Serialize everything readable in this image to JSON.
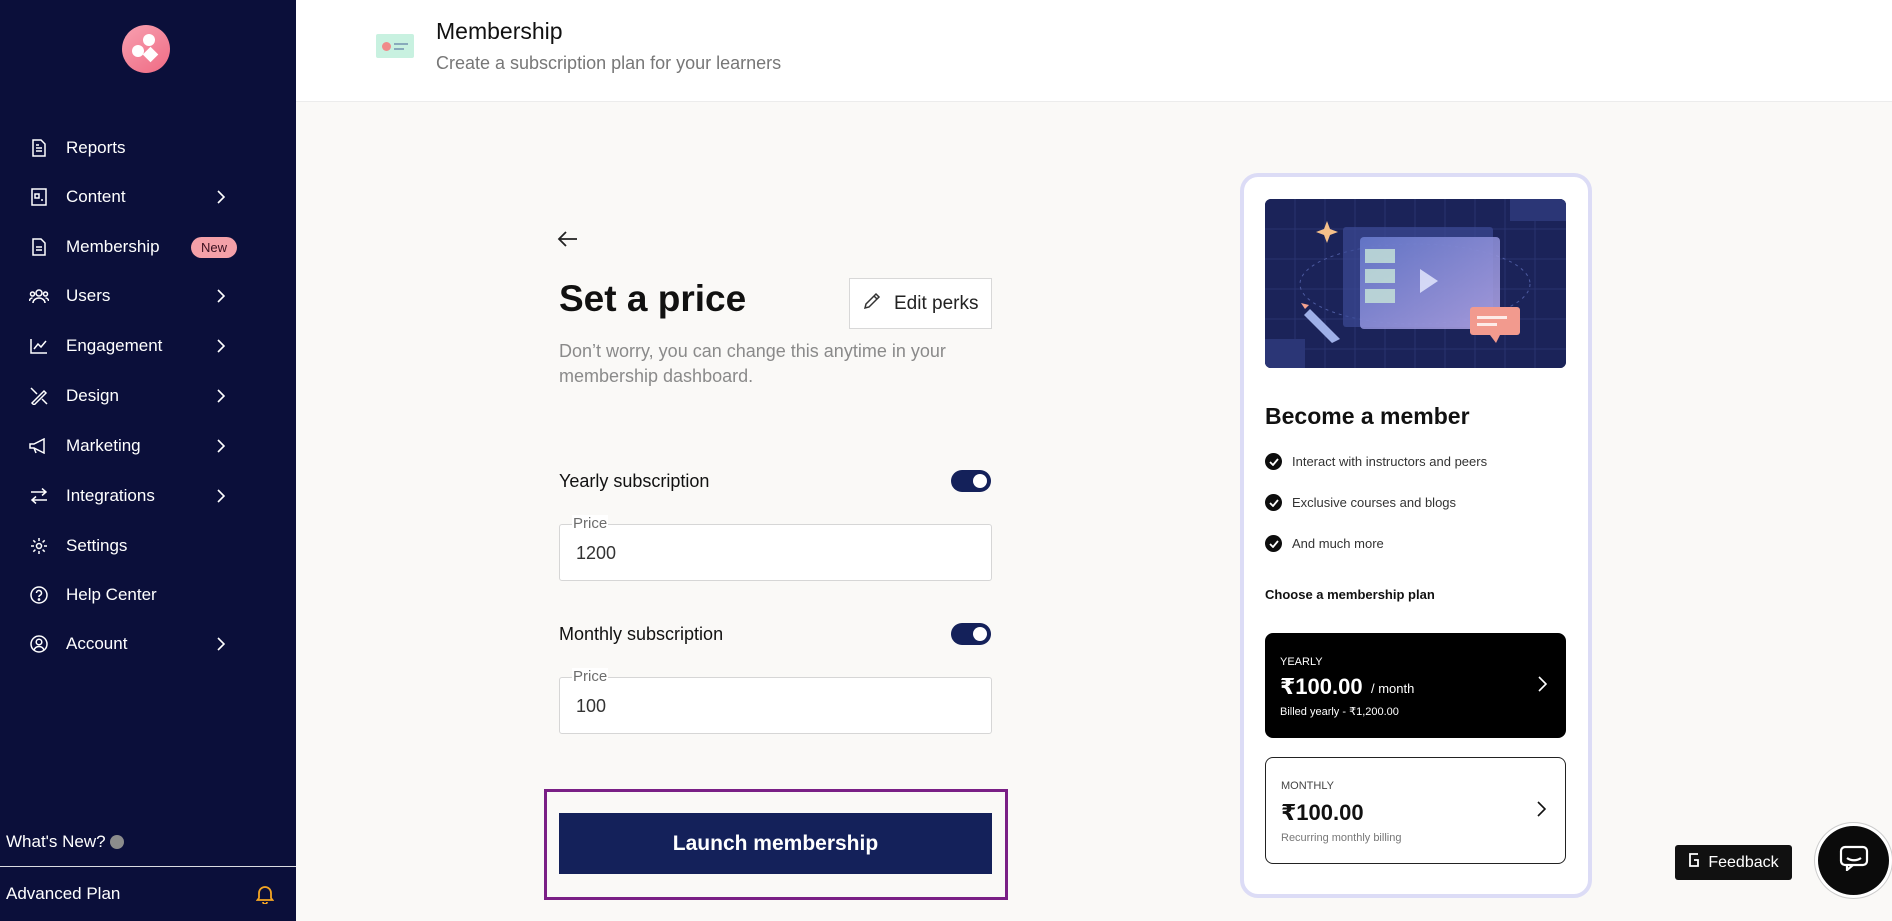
{
  "sidebar": {
    "items": [
      {
        "label": "Reports",
        "icon": "report-icon",
        "has_chevron": false
      },
      {
        "label": "Content",
        "icon": "content-icon",
        "has_chevron": true
      },
      {
        "label": "Membership",
        "icon": "membership-icon",
        "has_chevron": false,
        "badge": "New"
      },
      {
        "label": "Users",
        "icon": "users-icon",
        "has_chevron": true
      },
      {
        "label": "Engagement",
        "icon": "engagement-icon",
        "has_chevron": true
      },
      {
        "label": "Design",
        "icon": "design-icon",
        "has_chevron": true
      },
      {
        "label": "Marketing",
        "icon": "megaphone-icon",
        "has_chevron": true
      },
      {
        "label": "Integrations",
        "icon": "integrations-icon",
        "has_chevron": true
      },
      {
        "label": "Settings",
        "icon": "gear-icon",
        "has_chevron": false
      },
      {
        "label": "Help Center",
        "icon": "help-icon",
        "has_chevron": false
      },
      {
        "label": "Account",
        "icon": "account-icon",
        "has_chevron": true
      }
    ],
    "whats_new": "What's New?",
    "plan": "Advanced Plan"
  },
  "header": {
    "title": "Membership",
    "subtitle": "Create a subscription plan for your learners"
  },
  "form": {
    "title": "Set a price",
    "edit_perks": "Edit perks",
    "description": "Don’t worry, you can change this anytime in your membership dashboard.",
    "yearly": {
      "label": "Yearly subscription",
      "enabled": true,
      "price_label": "Price",
      "price_value": "1200"
    },
    "monthly": {
      "label": "Monthly subscription",
      "enabled": true,
      "price_label": "Price",
      "price_value": "100"
    },
    "launch": "Launch membership"
  },
  "preview": {
    "title": "Become a member",
    "perks": [
      "Interact with instructors and peers",
      "Exclusive courses and blogs",
      "And much more"
    ],
    "choose": "Choose a membership plan",
    "yearly_plan": {
      "type": "YEARLY",
      "price": "₹100.00",
      "per": "/ month",
      "note": "Billed yearly - ₹1,200.00"
    },
    "monthly_plan": {
      "type": "MONTHLY",
      "price": "₹100.00",
      "note": "Recurring monthly billing"
    }
  },
  "feedback": "Feedback",
  "colors": {
    "sidebar_bg": "#0b0f3a",
    "primary": "#14215a",
    "badge": "#f4a0a8",
    "highlight_frame": "#7a1f86"
  }
}
